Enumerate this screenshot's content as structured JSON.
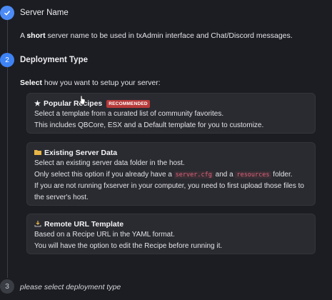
{
  "steps": [
    {
      "number": "",
      "status": "done",
      "title": "Server Name",
      "description": {
        "prefix": "A ",
        "bold": "short",
        "suffix": " server name to be used in txAdmin interface and Chat/Discord messages."
      }
    },
    {
      "number": "2",
      "status": "active",
      "title": "Deployment Type",
      "instruction": {
        "bold": "Select",
        "suffix": " how you want to setup your server:"
      }
    },
    {
      "number": "3",
      "status": "pending",
      "title": "please select deployment type"
    }
  ],
  "options": {
    "popular": {
      "icon": "star-icon",
      "title": "Popular Recipes",
      "badge": "RECOMMENDED",
      "line1": "Select a template from a curated list of community favorites.",
      "line2": "This includes QBCore, ESX and a Default template for you to customize."
    },
    "existing": {
      "icon": "folder-icon",
      "title": "Existing Server Data",
      "line1": "Select an existing server data folder in the host.",
      "line2_prefix": "Only select this option if you already have a ",
      "line2_code1": "server.cfg",
      "line2_mid": " and a ",
      "line2_code2": "resources",
      "line2_suffix": " folder.",
      "line3": "If you are not running fxserver in your computer, you need to first upload those files to",
      "line4": "the server's host."
    },
    "remote": {
      "icon": "download-icon",
      "title": "Remote URL Template",
      "line1": "Based on a Recipe URL in the YAML format.",
      "line2": "You will have the option to edit the Recipe before running it."
    }
  },
  "colors": {
    "accent": "#4c8bf5",
    "badge": "#b83a3a",
    "code": "#e0607a"
  }
}
